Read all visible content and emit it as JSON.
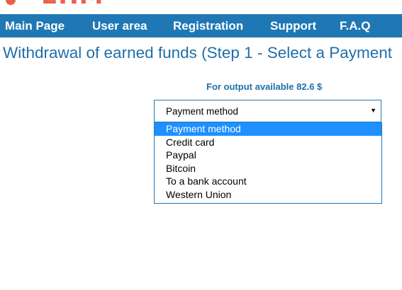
{
  "logo": {
    "text": "EHM"
  },
  "nav": {
    "items": [
      "Main Page",
      "User area",
      "Registration",
      "Support",
      "F.A.Q"
    ]
  },
  "page": {
    "title": "Withdrawal of earned funds (Step 1 - Select a Payment"
  },
  "balance": {
    "text": "For output available 82.6 $"
  },
  "payment_select": {
    "value": "Payment method",
    "caret": "▼",
    "options": [
      "Payment method",
      "Credit card",
      "Paypal",
      "Bitcoin",
      "To a bank account",
      "Western Union"
    ],
    "selected_index": 0
  },
  "colors": {
    "nav_bg": "#1f78b4",
    "title": "#1f6fa8",
    "logo": "#e8614f",
    "highlight": "#1e90ff"
  }
}
